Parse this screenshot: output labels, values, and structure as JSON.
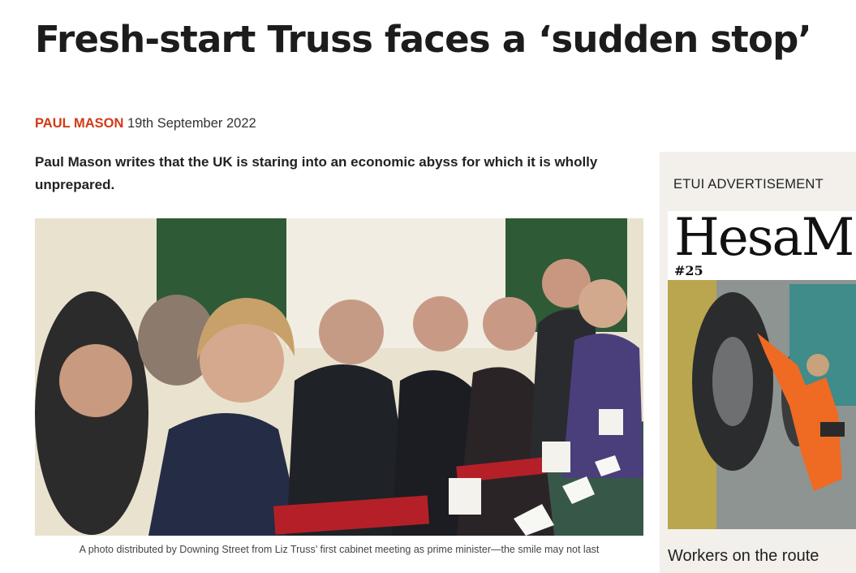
{
  "article": {
    "headline": "Fresh-start Truss faces a ‘sudden stop’",
    "author": "PAUL MASON",
    "date": "19th September 2022",
    "standfirst": "Paul Mason writes that the UK is staring into an economic abyss for which it is wholly unprepared.",
    "caption": "A photo distributed by Downing Street from Liz Truss’ first cabinet meeting as prime minister—the smile may not last"
  },
  "sidebar": {
    "ad_label": "ETUI ADVERTISEMENT",
    "magazine_title": "HesaM",
    "magazine_issue": "#25",
    "teaser": "Workers on the route"
  },
  "colors": {
    "author_accent": "#d23a17",
    "sidebar_bg": "#f3f0ec"
  }
}
